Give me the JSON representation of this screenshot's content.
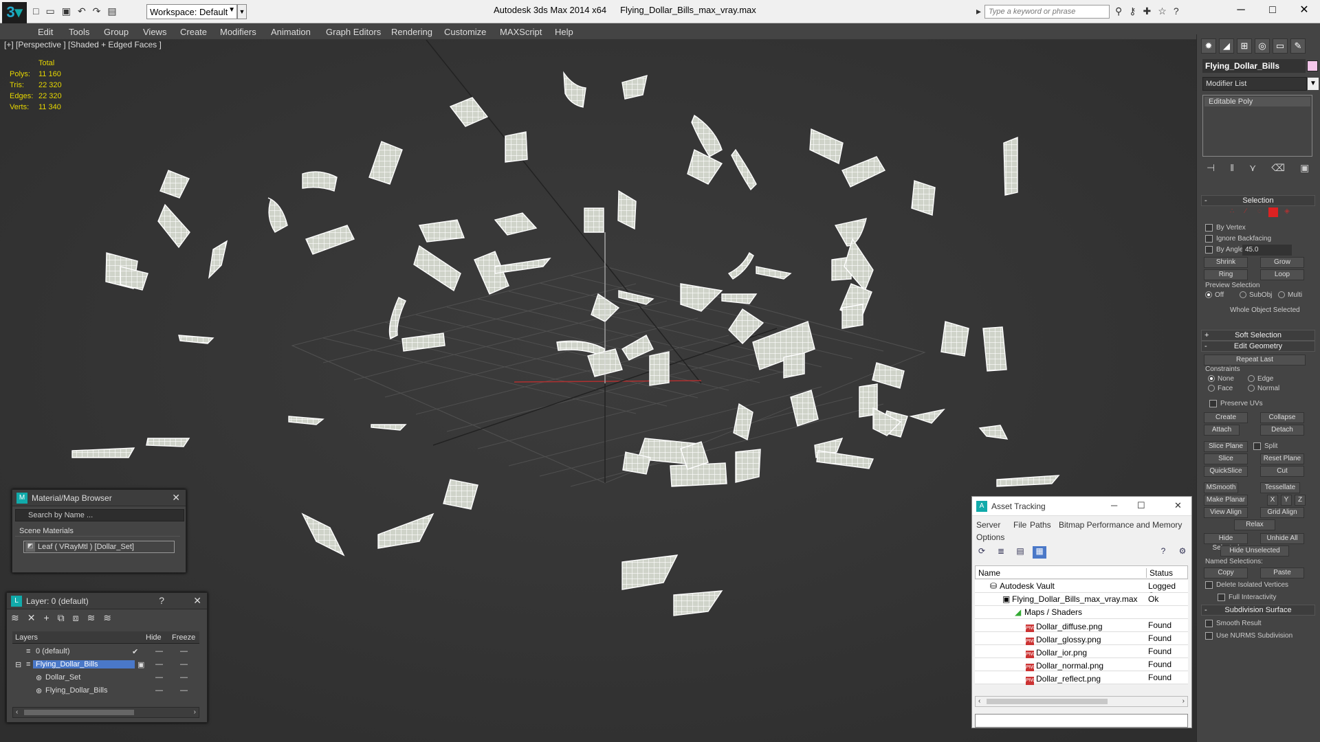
{
  "titlebar": {
    "workspace": "Workspace: Default",
    "app_name": "Autodesk 3ds Max  2014 x64",
    "file_name": "Flying_Dollar_Bills_max_vray.max",
    "search_placeholder": "Type a keyword or phrase"
  },
  "menu": [
    "Edit",
    "Tools",
    "Group",
    "Views",
    "Create",
    "Modifiers",
    "Animation",
    "Graph Editors",
    "Rendering",
    "Customize",
    "MAXScript",
    "Help"
  ],
  "viewport": {
    "label": "[+] [Perspective ] [Shaded + Edged Faces ]",
    "stats_header": "Total",
    "stats": [
      {
        "k": "Polys:",
        "v": "11 160"
      },
      {
        "k": "Tris:",
        "v": "22 320"
      },
      {
        "k": "Edges:",
        "v": "22 320"
      },
      {
        "k": "Verts:",
        "v": "11 340"
      }
    ]
  },
  "command_panel": {
    "object_name": "Flying_Dollar_Bills",
    "object_color": "#f4c6ea",
    "modifier_list": "Modifier List",
    "stack": [
      "Editable Poly"
    ],
    "selection": {
      "title": "Selection",
      "by_vertex": "By Vertex",
      "ignore_backfacing": "Ignore Backfacing",
      "by_angle": "By Angle:",
      "angle": "45.0",
      "shrink": "Shrink",
      "grow": "Grow",
      "ring": "Ring",
      "loop": "Loop",
      "preview": "Preview Selection",
      "off": "Off",
      "subobj": "SubObj",
      "multi": "Multi",
      "status": "Whole Object Selected"
    },
    "soft_selection": "Soft Selection",
    "edit_geometry": {
      "title": "Edit Geometry",
      "repeat": "Repeat Last",
      "constraints": "Constraints",
      "none": "None",
      "edge": "Edge",
      "face": "Face",
      "normal": "Normal",
      "preserve_uvs": "Preserve UVs",
      "create": "Create",
      "collapse": "Collapse",
      "attach": "Attach",
      "detach": "Detach",
      "slice_plane": "Slice Plane",
      "split": "Split",
      "slice": "Slice",
      "reset_plane": "Reset Plane",
      "quickslice": "QuickSlice",
      "cut": "Cut",
      "msmooth": "MSmooth",
      "tessellate": "Tessellate",
      "make_planar": "Make Planar",
      "x": "X",
      "y": "Y",
      "z": "Z",
      "view_align": "View Align",
      "grid_align": "Grid Align",
      "relax": "Relax",
      "hide_selected": "Hide Selected",
      "unhide_all": "Unhide All",
      "hide_unselected": "Hide Unselected",
      "named_selections": "Named Selections:",
      "copy": "Copy",
      "paste": "Paste",
      "delete_isolated": "Delete Isolated Vertices",
      "full_interactivity": "Full Interactivity"
    },
    "subdivision": {
      "title": "Subdivision Surface",
      "smooth_result": "Smooth Result",
      "use_nurms": "Use NURMS Subdivision"
    }
  },
  "material_browser": {
    "title": "Material/Map Browser",
    "search": "Search by Name ...",
    "group": "Scene Materials",
    "item": "Leaf  ( VRayMtl )  [Dollar_Set]"
  },
  "layer_panel": {
    "title": "Layer: 0 (default)",
    "help": "?",
    "col_layers": "Layers",
    "col_hide": "Hide",
    "col_freeze": "Freeze",
    "rows": [
      {
        "name": "0 (default)"
      },
      {
        "name": "Flying_Dollar_Bills"
      },
      {
        "name": "Dollar_Set"
      },
      {
        "name": "Flying_Dollar_Bills"
      }
    ]
  },
  "asset_tracking": {
    "title": "Asset Tracking",
    "menu": [
      "Server",
      "File",
      "Paths",
      "Bitmap Performance and Memory",
      "Options"
    ],
    "col_name": "Name",
    "col_status": "Status",
    "rows": [
      {
        "name": "Autodesk Vault",
        "status": "Logged Out"
      },
      {
        "name": "Flying_Dollar_Bills_max_vray.max",
        "status": "Ok"
      },
      {
        "name": "Maps / Shaders",
        "status": ""
      },
      {
        "name": "Dollar_diffuse.png",
        "status": "Found"
      },
      {
        "name": "Dollar_glossy.png",
        "status": "Found"
      },
      {
        "name": "Dollar_ior.png",
        "status": "Found"
      },
      {
        "name": "Dollar_normal.png",
        "status": "Found"
      },
      {
        "name": "Dollar_reflect.png",
        "status": "Found"
      }
    ]
  }
}
